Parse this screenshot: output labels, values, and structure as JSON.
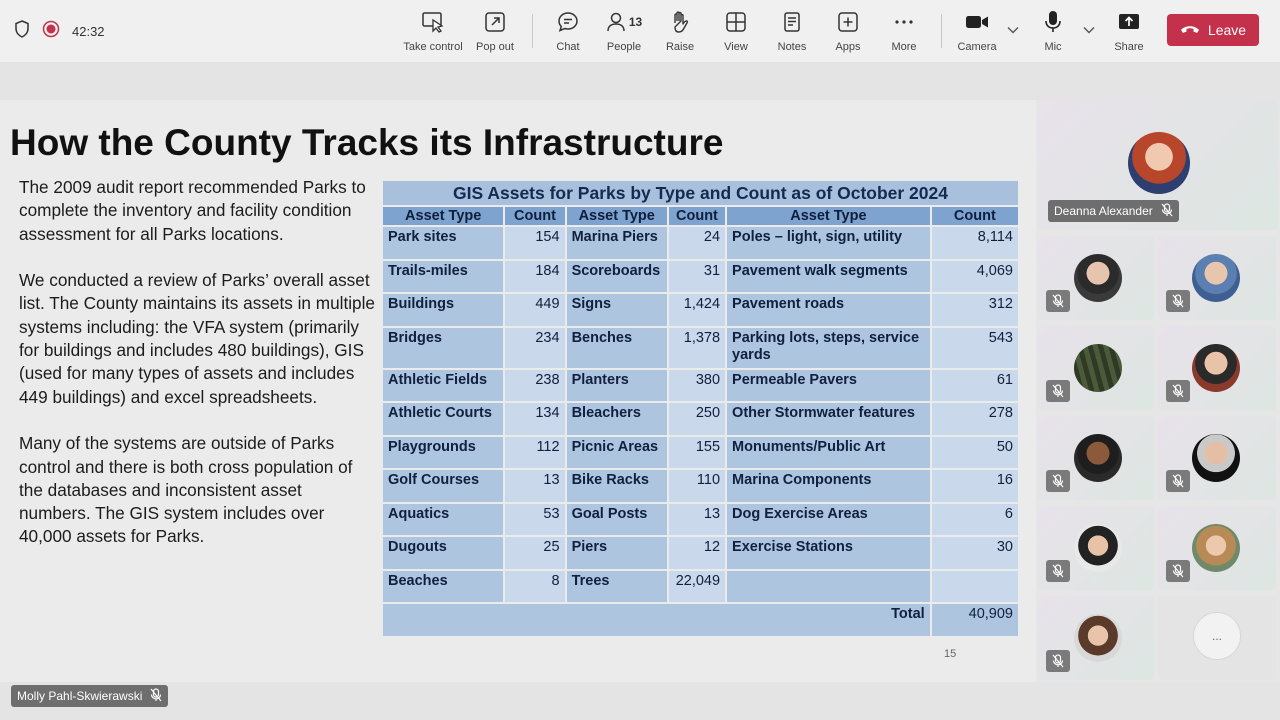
{
  "toolbar": {
    "timer": "42:32",
    "buttons": {
      "take_control": "Take control",
      "pop_out": "Pop out",
      "chat": "Chat",
      "people": "People",
      "people_count": "13",
      "raise": "Raise",
      "view": "View",
      "notes": "Notes",
      "apps": "Apps",
      "more": "More",
      "camera": "Camera",
      "mic": "Mic",
      "share": "Share",
      "leave": "Leave"
    }
  },
  "slide": {
    "title": "How the County Tracks its Infrastructure",
    "paragraphs": [
      "The 2009 audit report recommended Parks to complete the inventory and facility condition assessment for all Parks locations.",
      "We conducted a review of Parks’ overall asset list. The County maintains its assets in multiple systems including: the VFA system (primarily for buildings and includes 480 buildings), GIS (used for many types of assets and includes 449 buildings) and excel spreadsheets.",
      "Many of the systems are outside of Parks control and there is both cross population of the databases and inconsistent asset numbers. The GIS system includes over 40,000 assets for Parks."
    ],
    "page_number": "15",
    "table": {
      "title": "GIS Assets for Parks by Type and Count as of October 2024",
      "headers": [
        "Asset Type",
        "Count",
        "Asset Type",
        "Count",
        "Asset Type",
        "Count"
      ],
      "rows": [
        [
          "Park sites",
          "154",
          "Marina Piers",
          "24",
          "Poles – light, sign, utility",
          "8,114"
        ],
        [
          "Trails-miles",
          "184",
          "Scoreboards",
          "31",
          "Pavement walk segments",
          "4,069"
        ],
        [
          "Buildings",
          "449",
          "Signs",
          "1,424",
          "Pavement roads",
          "312"
        ],
        [
          "Bridges",
          "234",
          "Benches",
          "1,378",
          "Parking lots, steps, service yards",
          "543"
        ],
        [
          "Athletic Fields",
          "238",
          "Planters",
          "380",
          "Permeable Pavers",
          "61"
        ],
        [
          "Athletic Courts",
          "134",
          "Bleachers",
          "250",
          "Other Stormwater features",
          "278"
        ],
        [
          "Playgrounds",
          "112",
          "Picnic Areas",
          "155",
          "Monuments/Public Art",
          "50"
        ],
        [
          "Golf Courses",
          "13",
          "Bike Racks",
          "110",
          "Marina Components",
          "16"
        ],
        [
          "Aquatics",
          "53",
          "Goal Posts",
          "13",
          "Dog Exercise Areas",
          "6"
        ],
        [
          "Dugouts",
          "25",
          "Piers",
          "12",
          "Exercise Stations",
          "30"
        ],
        [
          "Beaches",
          "8",
          "Trees",
          "22,049",
          "",
          ""
        ]
      ],
      "total_label": "Total",
      "total_value": "40,909"
    }
  },
  "participants": {
    "featured_name": "Deanna Alexander",
    "presenter_name": "Molly Pahl-Skwierawski",
    "more_label": "..."
  },
  "colors": {
    "leave": "#c4314b",
    "table_header": "#7fa3cf",
    "table_cell": "#aec5e0"
  }
}
